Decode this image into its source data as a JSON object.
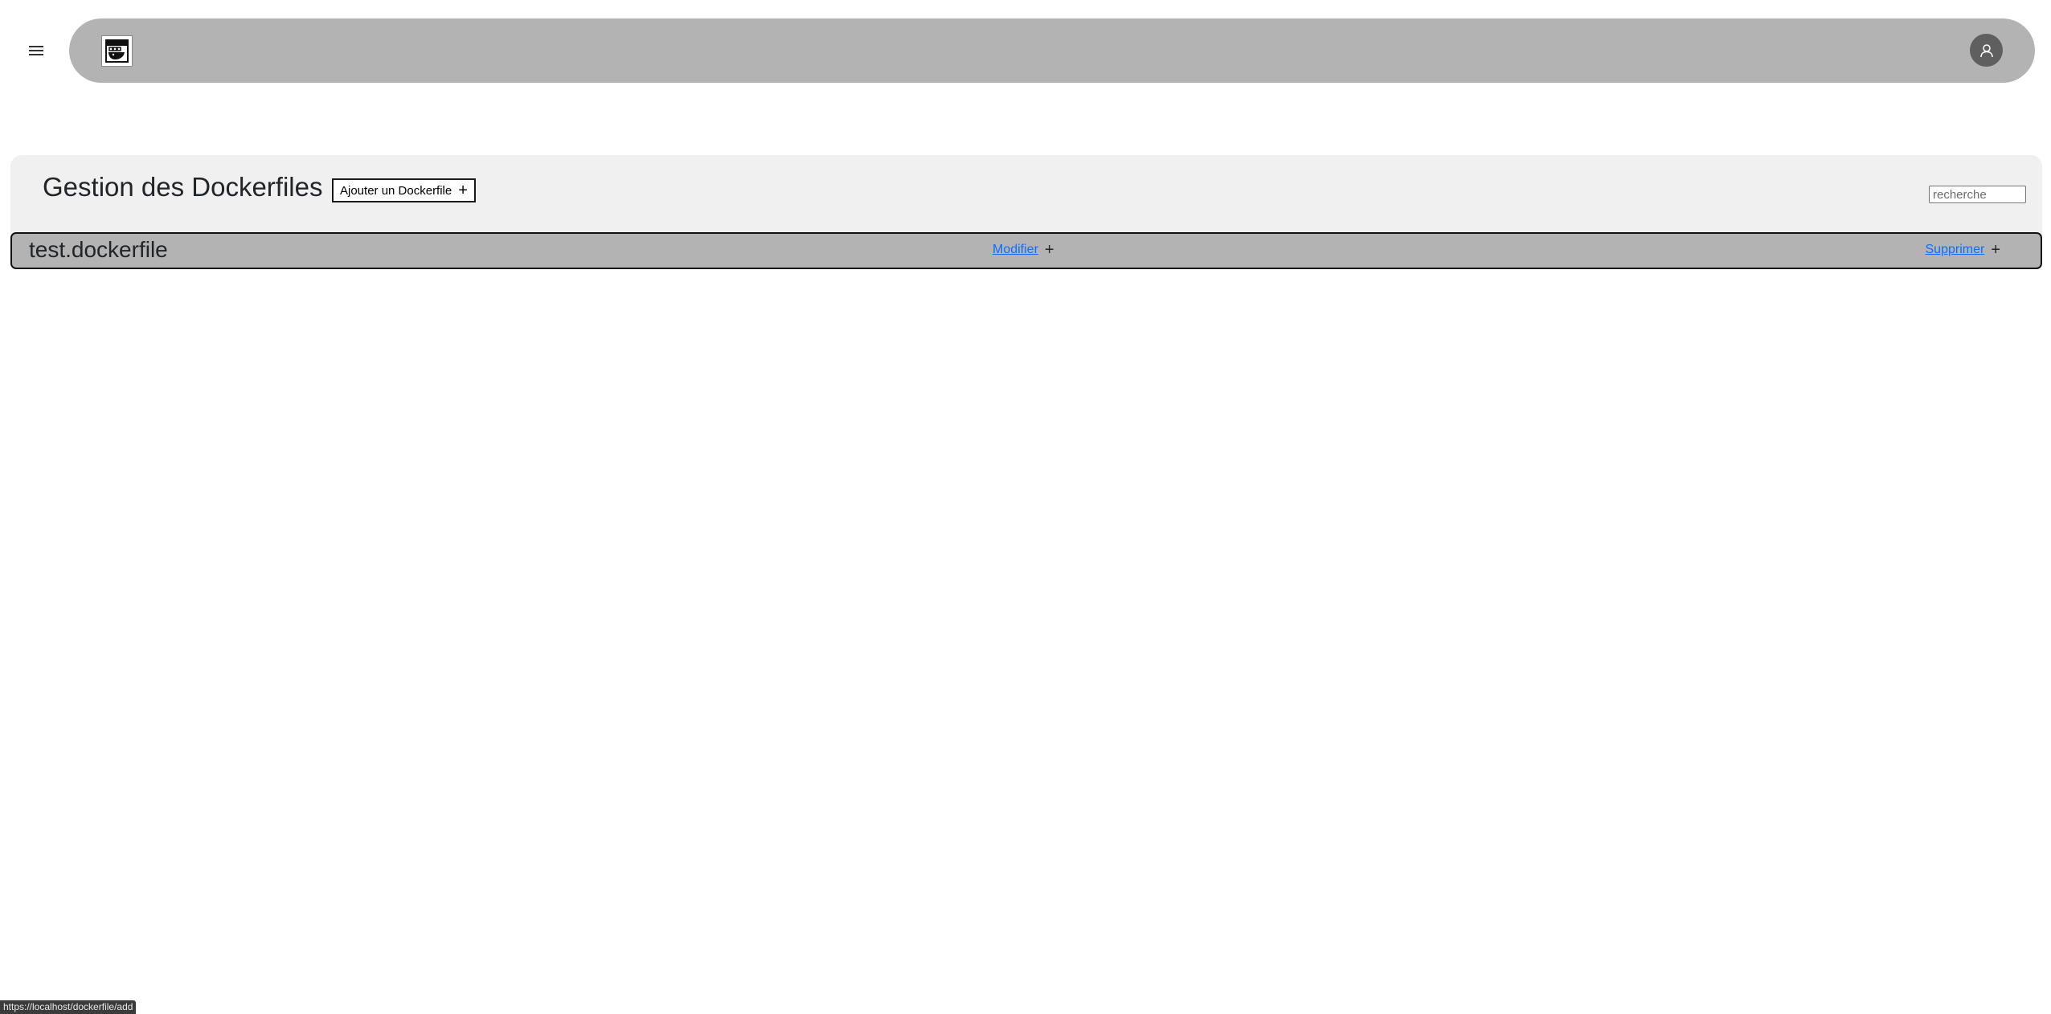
{
  "header": {
    "menu_icon": "hamburger-menu-icon",
    "logo_icon": "docker-logo-icon",
    "avatar_icon": "user-avatar-icon"
  },
  "main": {
    "title": "Gestion des Dockerfiles",
    "add_button_label": "Ajouter un Dockerfile",
    "add_button_icon": "+",
    "search_placeholder": "recherche"
  },
  "dockerfiles": [
    {
      "name": "test.dockerfile",
      "modify_label": "Modifier",
      "modify_icon": "+",
      "delete_label": "Supprimer",
      "delete_icon": "+"
    }
  ],
  "status_bar": {
    "url": "https://localhost/dockerfile/add"
  },
  "colors": {
    "navbar": "#b3b3b3",
    "panel": "#f0f0f0",
    "row": "#b3b3b3",
    "link": "#0d6efd",
    "avatar": "#5f5f5f"
  }
}
